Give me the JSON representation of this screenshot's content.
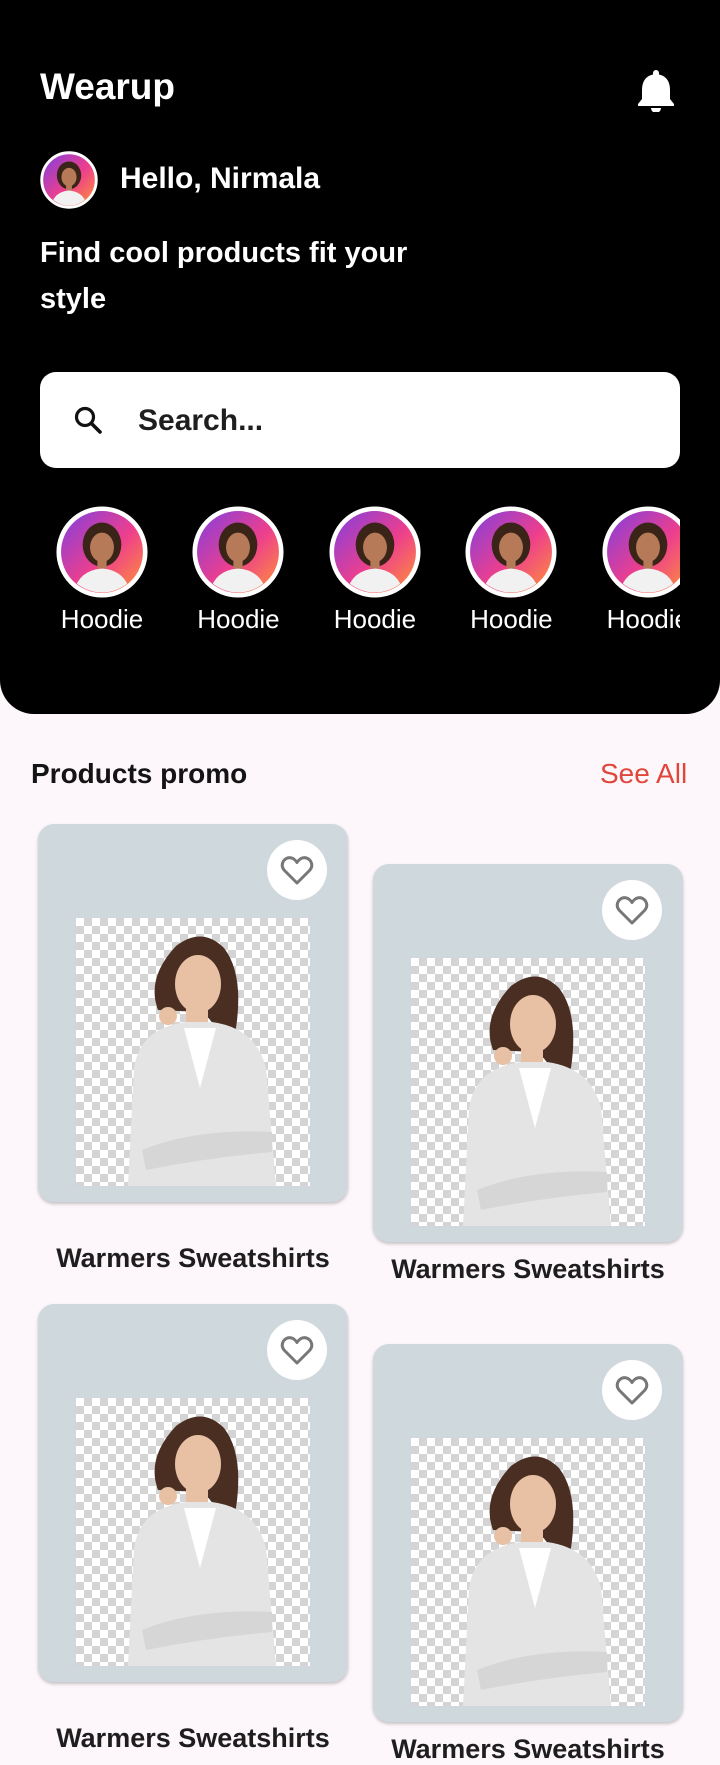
{
  "app": {
    "title": "Wearup"
  },
  "header": {
    "greeting": "Hello, Nirmala",
    "tagline": "Find cool products fit your style"
  },
  "search": {
    "placeholder": "Search..."
  },
  "categories": [
    {
      "label": "Hoodie"
    },
    {
      "label": "Hoodie"
    },
    {
      "label": "Hoodie"
    },
    {
      "label": "Hoodie"
    },
    {
      "label": "Hoodie"
    }
  ],
  "promo": {
    "title": "Products promo",
    "see_all": "See All",
    "products": [
      {
        "name": "Warmers Sweatshirts"
      },
      {
        "name": "Warmers Sweatshirts"
      },
      {
        "name": "Warmers Sweatshirts"
      },
      {
        "name": "Warmers Sweatshirts"
      }
    ]
  },
  "colors": {
    "header_bg": "#000000",
    "accent": "#e0473a",
    "card_bg": "#cfd8dc",
    "page_bg": "#fdf7fb"
  },
  "icons": {
    "notification": "bell-icon",
    "search": "search-icon",
    "favorite": "heart-outline-icon"
  }
}
